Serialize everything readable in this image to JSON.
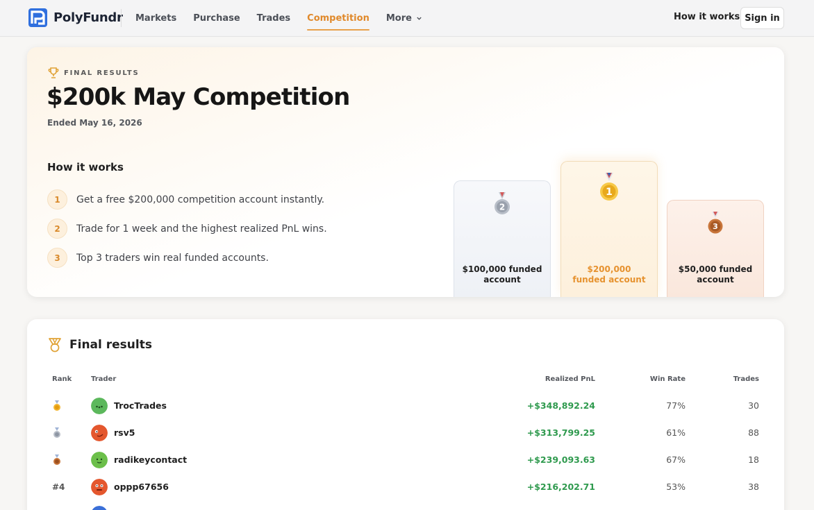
{
  "app": {
    "name": "PolyFundr"
  },
  "nav": {
    "links": [
      {
        "label": "Markets",
        "active": false
      },
      {
        "label": "Purchase",
        "active": false
      },
      {
        "label": "Trades",
        "active": false
      },
      {
        "label": "Competition",
        "active": true
      },
      {
        "label": "More",
        "active": false
      }
    ],
    "how_it_works": "How it works",
    "sign_in": "Sign in"
  },
  "hero": {
    "eyebrow": "FINAL RESULTS",
    "title": "$200k May Competition",
    "subtitle": "Ended May 16, 2026",
    "how_title": "How it works",
    "steps": [
      {
        "num": "1",
        "text": "Get a free $200,000 competition account instantly."
      },
      {
        "num": "2",
        "text": "Trade for 1 week and the highest realized PnL wins."
      },
      {
        "num": "3",
        "text": "Top 3 traders win real funded accounts."
      }
    ],
    "prizes": [
      {
        "place": "2",
        "label_line1": "$100,000 funded",
        "label_line2": "account"
      },
      {
        "place": "1",
        "label_line1": "$200,000",
        "label_line2": "funded account"
      },
      {
        "place": "3",
        "label_line1": "$50,000 funded",
        "label_line2": "account"
      }
    ]
  },
  "results": {
    "title": "Final results",
    "columns": {
      "rank": "Rank",
      "trader": "Trader",
      "pnl": "Realized PnL",
      "win_rate": "Win Rate",
      "trades": "Trades"
    },
    "rows": [
      {
        "rank": "1",
        "rank_label": "",
        "trader": "TrocTrades",
        "pnl": "+$348,892.24",
        "win_rate": "77%",
        "trades": "30",
        "avatar_color": "#5cb85c"
      },
      {
        "rank": "2",
        "rank_label": "",
        "trader": "rsv5",
        "pnl": "+$313,799.25",
        "win_rate": "61%",
        "trades": "88",
        "avatar_color": "#e4572e"
      },
      {
        "rank": "3",
        "rank_label": "",
        "trader": "radikeycontact",
        "pnl": "+$239,093.63",
        "win_rate": "67%",
        "trades": "18",
        "avatar_color": "#6cbf4a"
      },
      {
        "rank": "4",
        "rank_label": "#4",
        "trader": "oppp67656",
        "pnl": "+$216,202.71",
        "win_rate": "53%",
        "trades": "38",
        "avatar_color": "#e4572e"
      }
    ]
  },
  "colors": {
    "accent": "#e0892b",
    "positive": "#2f9a4e"
  }
}
